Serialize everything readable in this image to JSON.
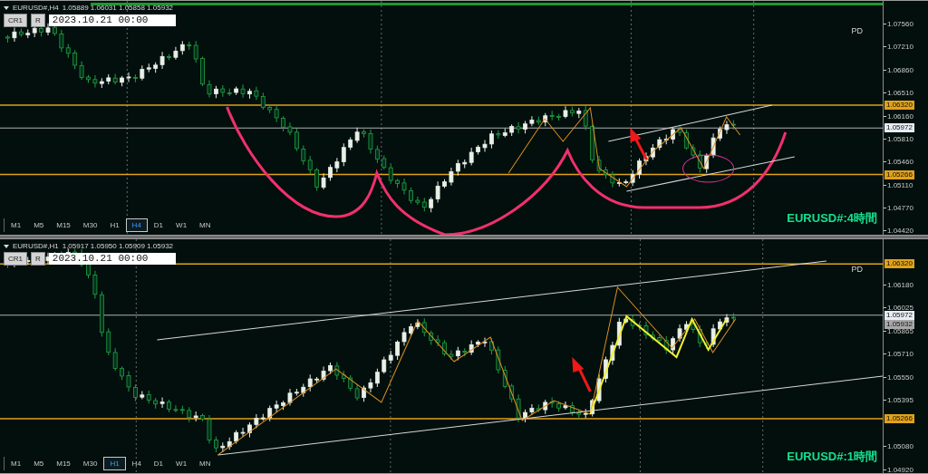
{
  "panels": [
    {
      "symbol": "EURUSD#,H4",
      "ohlc": [
        "1.05889",
        "1.06031",
        "1.05858",
        "1.05932"
      ],
      "buttons": [
        "CR1",
        "R"
      ],
      "date": "2023.10.21 00:00",
      "pd": "PD",
      "trade_bar": true,
      "label": "EURUSD#:4時間",
      "price_ticks": [
        "1.07560",
        "1.07210",
        "1.06860",
        "1.06510",
        "1.06160",
        "1.05810",
        "1.05460",
        "1.05110",
        "1.04770",
        "1.04420"
      ],
      "price_tags": [
        {
          "text": "1.06320",
          "kind": "level"
        },
        {
          "text": "1.05972",
          "kind": "bid"
        },
        {
          "text": "1.05266",
          "kind": "level"
        }
      ],
      "timeframes": [
        {
          "label": "M1",
          "selected": false
        },
        {
          "label": "M5",
          "selected": false
        },
        {
          "label": "M15",
          "selected": false
        },
        {
          "label": "M30",
          "selected": false
        },
        {
          "label": "H1",
          "selected": false
        },
        {
          "label": "H4",
          "selected": true
        },
        {
          "label": "D1",
          "selected": false
        },
        {
          "label": "W1",
          "selected": false
        },
        {
          "label": "MN",
          "selected": false
        }
      ]
    },
    {
      "symbol": "EURUSD#,H1",
      "ohlc": [
        "1.05917",
        "1.05950",
        "1.05909",
        "1.05932"
      ],
      "buttons": [
        "CR1",
        "R"
      ],
      "date": "2023.10.21 00:00",
      "pd": "PD",
      "trade_bar": false,
      "label": "EURUSD#:1時間",
      "price_ticks": [
        "1.06180",
        "1.06025",
        "1.05865",
        "1.05710",
        "1.05550",
        "1.05395",
        "1.05080",
        "1.04920"
      ],
      "price_tags": [
        {
          "text": "1.06320",
          "kind": "level"
        },
        {
          "text": "1.05972",
          "kind": "bid"
        },
        {
          "text": "1.05932",
          "kind": "last"
        },
        {
          "text": "1.05266",
          "kind": "level"
        }
      ],
      "timeframes": [
        {
          "label": "M1",
          "selected": false
        },
        {
          "label": "M5",
          "selected": false
        },
        {
          "label": "M15",
          "selected": false
        },
        {
          "label": "M30",
          "selected": false
        },
        {
          "label": "H1",
          "selected": true
        },
        {
          "label": "H4",
          "selected": false
        },
        {
          "label": "D1",
          "selected": false
        },
        {
          "label": "W1",
          "selected": false
        },
        {
          "label": "MN",
          "selected": false
        }
      ]
    }
  ]
}
